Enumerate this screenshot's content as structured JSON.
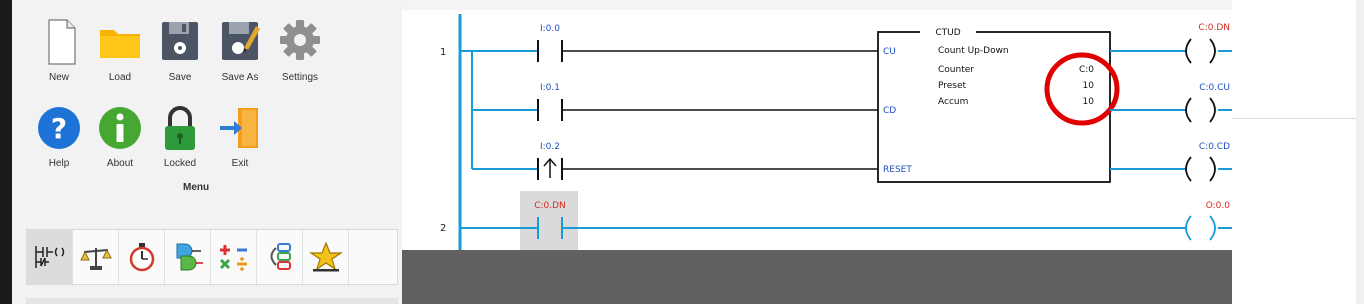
{
  "toolbar": {
    "new_label": "New",
    "load_label": "Load",
    "save_label": "Save",
    "saveas_label": "Save As",
    "settings_label": "Settings",
    "help_label": "Help",
    "about_label": "About",
    "locked_label": "Locked",
    "exit_label": "Exit",
    "menu_label": "Menu"
  },
  "palette": {
    "icons": [
      "ladder-contacts-icon",
      "balance-compare-icon",
      "stopwatch-timer-icon",
      "logic-gate-icon",
      "math-operators-icon",
      "data-move-icon",
      "star-favorite-icon"
    ],
    "selected_index": 0
  },
  "rungs": [
    {
      "number": "1"
    },
    {
      "number": "2"
    }
  ],
  "contacts": {
    "i00": "I:0.0",
    "i01": "I:0.1",
    "i02": "I:0.2",
    "c0dn_contact": "C:0.DN"
  },
  "block": {
    "title": "CTUD",
    "subtitle": "Count Up-Down",
    "cu_pin": "CU",
    "cd_pin": "CD",
    "reset_pin": "RESET",
    "counter_label": "Counter",
    "counter_value": "C:0",
    "preset_label": "Preset",
    "preset_value": "10",
    "accum_label": "Accum",
    "accum_value": "10"
  },
  "coils": {
    "c0dn": "C:0.DN",
    "c0cu": "C:0.CU",
    "c0cd": "C:0.CD",
    "o00": "O:0.0"
  },
  "colors": {
    "rail_blue": "#1a9bd7",
    "tag_blue": "#1f4fbf",
    "tag_red": "#d42a20",
    "highlight_circle": "#e00000"
  }
}
